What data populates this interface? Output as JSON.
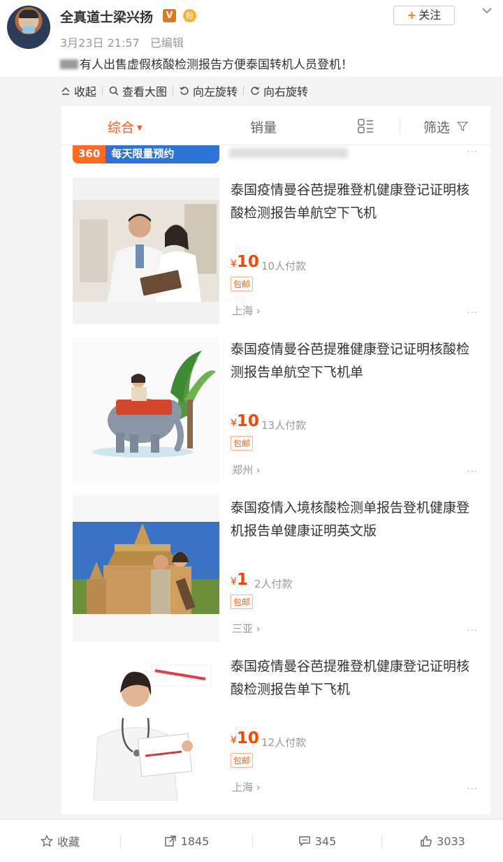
{
  "post": {
    "user_name": "全真道士梁兴扬",
    "verified_badge": "V",
    "fan_badge": "粉",
    "date": "3月23日 21:57",
    "edited": "已编辑",
    "follow_label": "关注",
    "text": "有人出售虚假核酸检测报告方便泰国转机人员登机！"
  },
  "toolbar": {
    "collapse": "收起",
    "view_large": "查看大图",
    "rotate_left": "向左旋转",
    "rotate_right": "向右旋转"
  },
  "shop": {
    "tabs": {
      "overall": "综合",
      "sales": "销量",
      "filter": "筛选"
    },
    "promo": {
      "number": "360",
      "text": "每天限量预约"
    },
    "items": [
      {
        "title": "泰国疫情曼谷芭提雅登机健康登记证明核酸检测报告单航空下飞机",
        "price_symbol": "¥",
        "price": "10",
        "sold": "10人付款",
        "shipping": "包邮",
        "location": "上海 ›"
      },
      {
        "title": "泰国疫情曼谷芭提雅健康登记证明核酸检测报告单航空下飞机单",
        "price_symbol": "¥",
        "price": "10",
        "sold": "13人付款",
        "shipping": "包邮",
        "location": "郑州 ›"
      },
      {
        "title": "泰国疫情入境核酸检测单报告登机健康登机报告单健康证明英文版",
        "price_symbol": "¥",
        "price": "1",
        "sold": "2人付款",
        "shipping": "包邮",
        "location": "三亚 ›"
      },
      {
        "title": "泰国疫情曼谷芭提雅登机健康登记证明核酸检测报告单下飞机",
        "price_symbol": "¥",
        "price": "10",
        "sold": "12人付款",
        "shipping": "包邮",
        "location": "上海 ›"
      }
    ]
  },
  "actions": {
    "favorite": "收藏",
    "reposts": "1845",
    "comments": "345",
    "likes": "3033"
  },
  "colors": {
    "accent_orange": "#ff8200",
    "price_red": "#ff4400",
    "tab_active": "#ff5a1f",
    "promo_blue": "#2d74d8"
  },
  "icons": [
    "chevron-down-icon",
    "collapse-icon",
    "magnifier-icon",
    "rotate-left-icon",
    "rotate-right-icon",
    "grid-view-icon",
    "filter-icon",
    "star-icon",
    "repost-icon",
    "comment-icon",
    "thumbs-up-icon"
  ]
}
